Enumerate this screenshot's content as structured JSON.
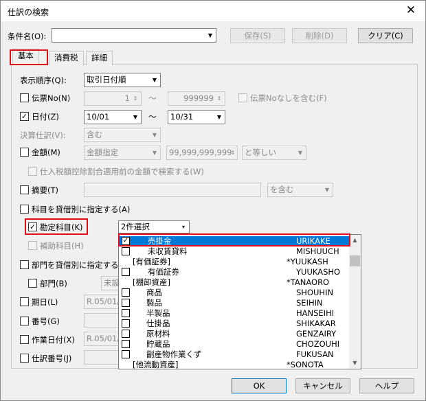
{
  "window": {
    "title": "仕訳の検索",
    "close": "✕"
  },
  "top": {
    "condition_label": "条件名(O):",
    "condition_value": "",
    "save_label": "保存(S)",
    "delete_label": "削除(D)",
    "clear_label": "クリア(C)"
  },
  "tabs": [
    "基本",
    "消費税",
    "詳細"
  ],
  "form": {
    "sort_label": "表示順序(Q):",
    "sort_value": "取引日付順",
    "voucher_label": "伝票No(N)",
    "voucher_from": "1",
    "voucher_to": "999999",
    "tilde": "～",
    "voucher_none_label": "伝票Noなしを含む(F)",
    "date_label": "日付(Z)",
    "date_from": "10/01",
    "date_to": "10/31",
    "settle_label": "決算仕訳(V):",
    "settle_value": "含む",
    "amount_label": "金額(M)",
    "amount_mode": "金額指定",
    "amount_value": "99,999,999,999",
    "amount_cond": "と等しい",
    "tax_before_label": "仕入税額控除割合適用前の金額で検索する(W)",
    "memo_label": "摘要(T)",
    "memo_value": "",
    "memo_cond": "を含む",
    "account_by_side_label": "科目を貸借別に指定する(A)",
    "account_label": "勘定科目(K)",
    "account_select": "2件選択",
    "sub_account_label": "補助科目(H)",
    "dept_by_side_label": "部門を貸借別に指定する(",
    "dept_label": "部門(B)",
    "dept_value": "未設",
    "period_label": "期日(L)",
    "period_value": "R.05/01/",
    "number_label": "番号(G)",
    "work_date_label": "作業日付(X)",
    "work_date_value": "R.05/01/",
    "journal_no_label": "仕訳番号(J)"
  },
  "account_list": [
    {
      "checkbox": true,
      "checked": true,
      "name": "売掛金",
      "code": "URIKAKE",
      "selected": true,
      "indent": 2
    },
    {
      "checkbox": true,
      "checked": false,
      "name": "未収賃貸料",
      "code": "MISHUUCH",
      "selected": false,
      "indent": 2
    },
    {
      "checkbox": false,
      "checked": false,
      "name": "[有価証券]",
      "code": "*YUUKASH",
      "selected": false,
      "indent": 0
    },
    {
      "checkbox": true,
      "checked": false,
      "name": "有価証券",
      "code": "YUUKASHO",
      "selected": false,
      "indent": 2
    },
    {
      "checkbox": false,
      "checked": false,
      "name": "[棚卸資産]",
      "code": "*TANAORO",
      "selected": false,
      "indent": 0
    },
    {
      "checkbox": true,
      "checked": false,
      "name": "商品",
      "code": "SHOUHIN",
      "selected": false,
      "indent": 1
    },
    {
      "checkbox": true,
      "checked": false,
      "name": "製品",
      "code": "SEIHIN",
      "selected": false,
      "indent": 1
    },
    {
      "checkbox": true,
      "checked": false,
      "name": "半製品",
      "code": "HANSEIHI",
      "selected": false,
      "indent": 1
    },
    {
      "checkbox": true,
      "checked": false,
      "name": "仕掛品",
      "code": "SHIKAKAR",
      "selected": false,
      "indent": 1
    },
    {
      "checkbox": true,
      "checked": false,
      "name": "原材料",
      "code": "GENZAIRY",
      "selected": false,
      "indent": 1
    },
    {
      "checkbox": true,
      "checked": false,
      "name": "貯蔵品",
      "code": "CHOZOUHI",
      "selected": false,
      "indent": 1
    },
    {
      "checkbox": true,
      "checked": false,
      "name": "副産物作業くず",
      "code": "FUKUSAN",
      "selected": false,
      "indent": 1
    },
    {
      "checkbox": false,
      "checked": false,
      "name": "[他流動資産]",
      "code": "*SONOTA",
      "selected": false,
      "indent": 0
    }
  ],
  "footer": {
    "ok_label": "OK",
    "cancel_label": "キャンセル",
    "help_label": "ヘルプ"
  },
  "icons": {
    "check": "check-icon",
    "dropdown": "chevron-down-icon",
    "spin": "spinner-icon"
  },
  "colors": {
    "highlight": "#e0101a",
    "selection": "#0078d7"
  }
}
